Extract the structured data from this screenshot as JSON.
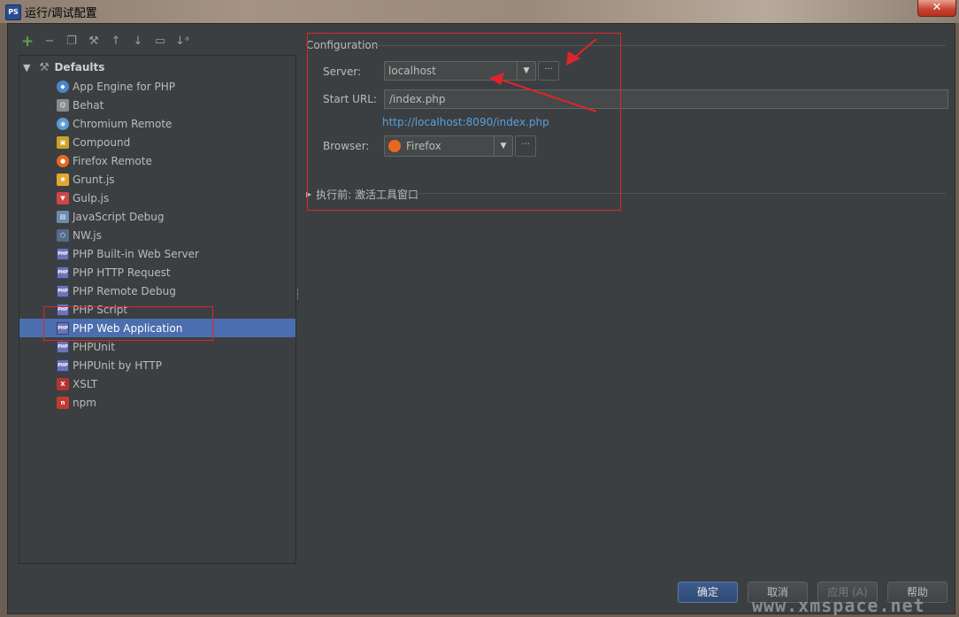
{
  "window": {
    "title": "运行/调试配置",
    "close_label": "✕",
    "app_icon": "phpstorm-icon"
  },
  "toolbar": [
    {
      "name": "add-config-icon",
      "glyph": "+"
    },
    {
      "name": "remove-config-icon",
      "glyph": "−"
    },
    {
      "name": "copy-config-icon",
      "glyph": "❐"
    },
    {
      "name": "edit-defaults-icon",
      "glyph": "⚒"
    },
    {
      "name": "move-up-icon",
      "glyph": "↑"
    },
    {
      "name": "move-down-icon",
      "glyph": "↓"
    },
    {
      "name": "folder-icon",
      "glyph": "▭"
    },
    {
      "name": "sort-icon",
      "glyph": "↓ᵃ"
    }
  ],
  "tree": {
    "root_label": "Defaults",
    "items": [
      {
        "label": "App Engine for PHP",
        "icon": "app-engine-icon",
        "color": "#4a86c8",
        "glyph": "◆",
        "round": true
      },
      {
        "label": "Behat",
        "icon": "behat-icon",
        "color": "#8a8a8a",
        "glyph": "☺",
        "round": false
      },
      {
        "label": "Chromium Remote",
        "icon": "chromium-icon",
        "color": "#5b9bd5",
        "glyph": "◉",
        "round": true
      },
      {
        "label": "Compound",
        "icon": "compound-icon",
        "color": "#c9a227",
        "glyph": "▣",
        "round": false
      },
      {
        "label": "Firefox Remote",
        "icon": "firefox-icon",
        "color": "#e8681f",
        "glyph": "●",
        "round": true
      },
      {
        "label": "Grunt.js",
        "icon": "grunt-icon",
        "color": "#e0a82e",
        "glyph": "✱",
        "round": false
      },
      {
        "label": "Gulp.js",
        "icon": "gulp-icon",
        "color": "#cf4647",
        "glyph": "▼",
        "round": false
      },
      {
        "label": "JavaScript Debug",
        "icon": "js-debug-icon",
        "color": "#6a8caf",
        "glyph": "▤",
        "round": false
      },
      {
        "label": "NW.js",
        "icon": "nwjs-icon",
        "color": "#556b8d",
        "glyph": "⬡",
        "round": false
      },
      {
        "label": "PHP Built-in Web Server",
        "icon": "php-icon",
        "color": "#6b74b6",
        "glyph": "PHP",
        "round": false
      },
      {
        "label": "PHP HTTP Request",
        "icon": "php-icon",
        "color": "#6b74b6",
        "glyph": "PHP",
        "round": false
      },
      {
        "label": "PHP Remote Debug",
        "icon": "php-icon",
        "color": "#6b74b6",
        "glyph": "PHP",
        "round": false
      },
      {
        "label": "PHP Script",
        "icon": "php-icon",
        "color": "#6b74b6",
        "glyph": "PHP",
        "round": false
      },
      {
        "label": "PHP Web Application",
        "icon": "php-icon",
        "color": "#6b74b6",
        "glyph": "PHP",
        "round": false,
        "selected": true
      },
      {
        "label": "PHPUnit",
        "icon": "phpunit-icon",
        "color": "#6b74b6",
        "glyph": "PHP",
        "round": false
      },
      {
        "label": "PHPUnit by HTTP",
        "icon": "phpunit-icon",
        "color": "#6b74b6",
        "glyph": "PHP",
        "round": false
      },
      {
        "label": "XSLT",
        "icon": "xslt-icon",
        "color": "#b5332e",
        "glyph": "X",
        "round": false
      },
      {
        "label": "npm",
        "icon": "npm-icon",
        "color": "#c23a2f",
        "glyph": "n",
        "round": false
      }
    ]
  },
  "config": {
    "section_label": "Configuration",
    "server_label": "Server:",
    "server_value": "localhost",
    "start_url_label": "Start URL:",
    "start_url_value": "/index.php",
    "full_url": "http://localhost:8090/index.php",
    "browser_label": "Browser:",
    "browser_value": "Firefox",
    "ellipsis": "···",
    "before_launch_label": "执行前: 激活工具窗口"
  },
  "buttons": {
    "ok": "确定",
    "cancel": "取消",
    "apply": "应用 (A)",
    "help": "帮助"
  },
  "watermark": "www.xmspace.net",
  "colors": {
    "selection": "#4b6eaf",
    "annotation": "#e0242c",
    "link": "#5a9fdc"
  }
}
